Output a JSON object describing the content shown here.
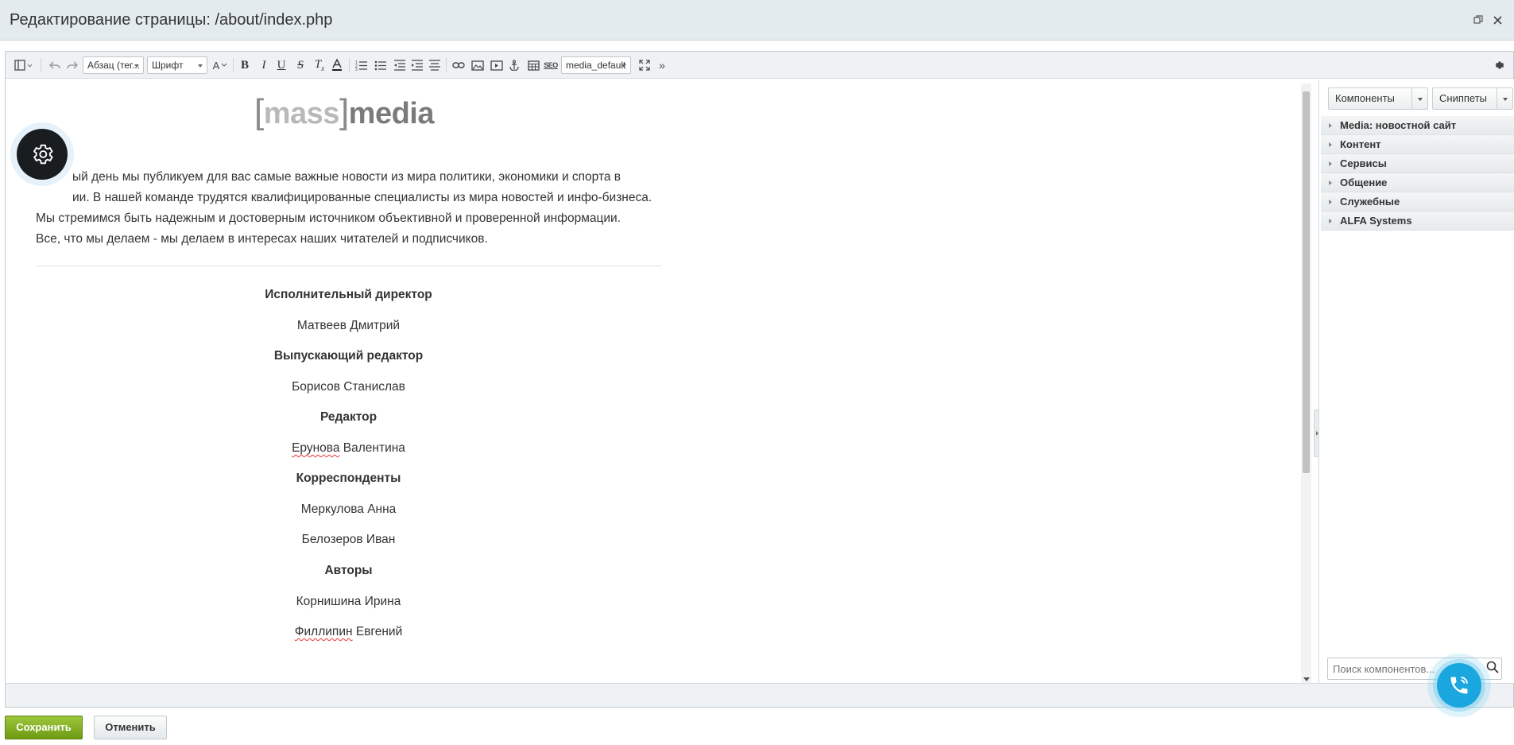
{
  "window": {
    "title": "Редактирование страницы: /about/index.php"
  },
  "toolbar": {
    "paragraph_select": "Абзац (тег...",
    "font_select": "Шрифт",
    "font_size_label": "A",
    "seo_label": "SEO",
    "template_select": "media_default",
    "more_label": "»"
  },
  "content": {
    "logo": {
      "bracket_open": "[",
      "mass": "mass",
      "bracket_close": "]",
      "media": "media"
    },
    "intro": [
      "ый день мы публикуем для вас самые важные новости из мира политики, экономики и спорта в",
      "ии. В нашей команде трудятся квалифицированные специалисты из мира новостей и инфо-бизнеса.",
      "Мы стремимся быть надежным и достоверным источником объективной и проверенной информации.",
      "Все, что мы делаем - мы делаем в интересах наших читателей и подписчиков."
    ],
    "staff": [
      {
        "text": "Исполнительный директор",
        "role": true
      },
      {
        "text": "Матвеев Дмитрий",
        "role": false
      },
      {
        "text": "Выпускающий редактор",
        "role": true
      },
      {
        "text": "Борисов Станислав",
        "role": false
      },
      {
        "text": "Редактор",
        "role": true
      },
      {
        "first": "Ерунова",
        "rest": " Валентина",
        "role": false
      },
      {
        "text": "Корреспонденты",
        "role": true
      },
      {
        "text": "Меркулова Анна",
        "role": false
      },
      {
        "text": "Белозеров Иван",
        "role": false
      },
      {
        "text": "Авторы",
        "role": true
      },
      {
        "text": "Корнишина Ирина",
        "role": false
      },
      {
        "first": "Филлипин",
        "rest": " Евгений",
        "role": false
      }
    ]
  },
  "sidebar": {
    "components_button": "Компоненты",
    "snippets_button": "Сниппеты",
    "groups": [
      "Media: новостной сайт",
      "Контент",
      "Сервисы",
      "Общение",
      "Служебные",
      "ALFA Systems"
    ],
    "search_placeholder": "Поиск компонентов..."
  },
  "footer": {
    "save_label": "Сохранить",
    "cancel_label": "Отменить"
  },
  "colors": {
    "save_green": "#7aa51c",
    "call_blue": "#1aa7df"
  }
}
